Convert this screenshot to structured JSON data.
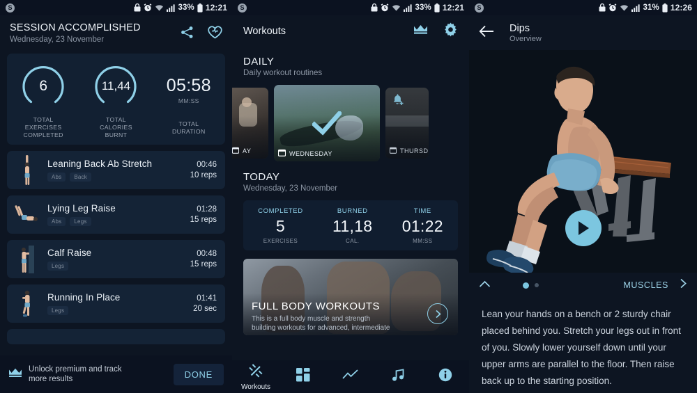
{
  "panel1": {
    "statusbar": {
      "app_icon": "s-badge-icon",
      "battery_pct": "33%",
      "time": "12:21"
    },
    "header": {
      "title": "SESSION ACCOMPLISHED",
      "subtitle": "Wednesday, 23 November",
      "share_icon": "share-icon",
      "favorite_icon": "heart-icon"
    },
    "stats": [
      {
        "value": "6",
        "label": "TOTAL\nEXERCISES\nCOMPLETED",
        "label_lines": [
          "TOTAL",
          "EXERCISES",
          "COMPLETED"
        ],
        "ring": true
      },
      {
        "value": "11,44",
        "label_lines": [
          "TOTAL",
          "CALORIES",
          "BURNT"
        ],
        "ring": true
      },
      {
        "value": "05:58",
        "units": "MM:SS",
        "label_lines": [
          "TOTAL",
          "DURATION"
        ],
        "ring": false
      }
    ],
    "exercises": [
      {
        "name": "Leaning Back Ab Stretch",
        "tags": [
          "Abs",
          "Back"
        ],
        "time": "00:46",
        "reps": "10 reps"
      },
      {
        "name": "Lying Leg Raise",
        "tags": [
          "Abs",
          "Legs"
        ],
        "time": "01:28",
        "reps": "15 reps"
      },
      {
        "name": "Calf Raise",
        "tags": [
          "Legs"
        ],
        "time": "00:48",
        "reps": "15 reps"
      },
      {
        "name": "Running In Place",
        "tags": [
          "Legs"
        ],
        "time": "01:41",
        "reps": "20 sec"
      }
    ],
    "bottom": {
      "premium_icon": "crown-icon",
      "premium_text_line1": "Unlock premium and track",
      "premium_text_line2": "more results",
      "done_label": "DONE"
    }
  },
  "panel2": {
    "statusbar": {
      "battery_pct": "33%",
      "time": "12:21"
    },
    "header": {
      "title": "Workouts",
      "crown_icon": "crown-icon",
      "settings_icon": "gear-icon"
    },
    "daily": {
      "title": "DAILY",
      "subtitle": "Daily workout routines",
      "cards": [
        {
          "label": "AY",
          "icon": "calendar-icon",
          "state": "past"
        },
        {
          "label": "WEDNESDAY",
          "icon": "calendar-icon",
          "state": "completed",
          "check_icon": "check-icon"
        },
        {
          "label": "THURSD",
          "icon": "calendar-icon",
          "state": "upcoming",
          "bell_icon": "bell-add-icon"
        }
      ]
    },
    "today": {
      "title": "TODAY",
      "subtitle": "Wednesday, 23 November",
      "stats": [
        {
          "head": "COMPLETED",
          "value": "5",
          "unit": "EXERCISES"
        },
        {
          "head": "BURNED",
          "value": "11,18",
          "unit": "CAL."
        },
        {
          "head": "TIME",
          "value": "01:22",
          "unit": "MM:SS"
        }
      ]
    },
    "promo": {
      "title": "FULL BODY WORKOUTS",
      "desc_line1": "This is a full body muscle and strength",
      "desc_line2": "building workouts for advanced, intermediate",
      "arrow_icon": "chevron-right-icon"
    },
    "tabs": [
      {
        "label": "Workouts",
        "icon": "dumbbell-icon",
        "active": true
      },
      {
        "label": "",
        "icon": "grid-icon",
        "active": false
      },
      {
        "label": "",
        "icon": "chart-line-icon",
        "active": false
      },
      {
        "label": "",
        "icon": "music-note-icon",
        "active": false
      },
      {
        "label": "",
        "icon": "info-icon",
        "active": false
      }
    ]
  },
  "panel3": {
    "statusbar": {
      "battery_pct": "31%",
      "time": "12:26"
    },
    "header": {
      "back_icon": "arrow-left-icon",
      "title": "Dips",
      "subtitle": "Overview"
    },
    "media": {
      "play_icon": "play-icon",
      "image": "dips-exercise-illustration"
    },
    "controls": {
      "collapse_icon": "chevron-up-icon",
      "muscles_label": "MUSCLES",
      "next_icon": "chevron-right-icon",
      "dots": 2,
      "active_dot": 0
    },
    "description": "Lean your hands on a bench or 2 sturdy chair placed behind you. Stretch your legs out in front of you. Slowly lower yourself down until your upper arms are parallel to the floor. Then raise back up to the starting position."
  },
  "colors": {
    "accent": "#8fd0e8",
    "play": "#7cc6e0",
    "bg": "#0d1522",
    "card": "#142336"
  }
}
